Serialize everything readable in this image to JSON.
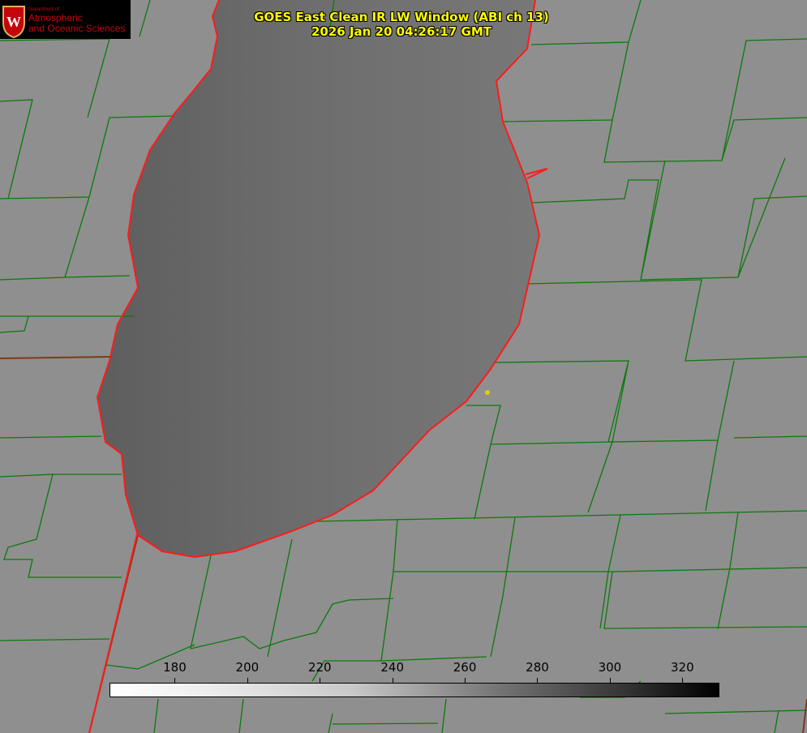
{
  "title": {
    "line1": "GOES East Clean IR LW Window (ABI ch 13)",
    "line2": "2026 Jan 20 04:26:17 GMT"
  },
  "logo": {
    "department": "Department of",
    "line1": "Atmospheric",
    "line2": "and Oceanic Sciences",
    "crest_letter": "W"
  },
  "colorbar": {
    "ticks": [
      "180",
      "200",
      "220",
      "240",
      "260",
      "280",
      "300",
      "320"
    ],
    "range": [
      162,
      330
    ],
    "colormap": "white-to-black"
  },
  "colors": {
    "background": "#8e8e8e",
    "lake": "#6c6c6c",
    "shoreline": "#ff1a1a",
    "county_lines": "#0b7a0b",
    "marker": "#e0d000",
    "title": "#ffff00"
  }
}
